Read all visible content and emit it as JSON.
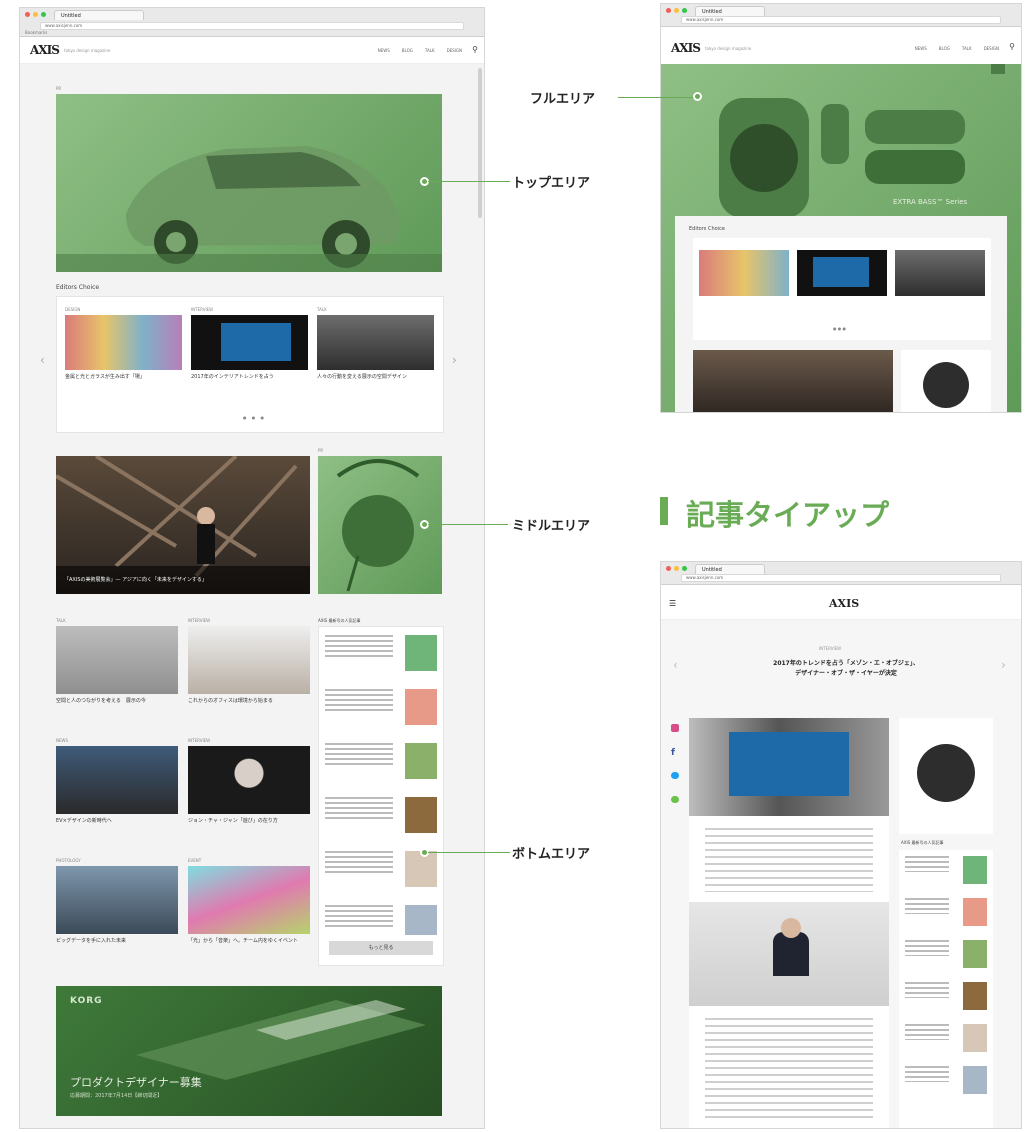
{
  "browser": {
    "tab_title": "Untitled",
    "url": "www.axisjenn.com",
    "bookmarks": "Bookmarks"
  },
  "site": {
    "logo": "AXIS",
    "tagline": "tokyo design magazine",
    "nav": [
      "NEWS",
      "BLOG",
      "TALK",
      "DESIGN"
    ],
    "search_icon": "search-icon"
  },
  "left_page": {
    "top_label": "PR",
    "editors_choice": "Editors Choice",
    "carousel_items": [
      {
        "tag": "DESIGN",
        "caption": "金属と光とガラスが生み出す「場」"
      },
      {
        "tag": "INTERVIEW",
        "caption": "2017年のインテリアトレンドを占う"
      },
      {
        "tag": "TALK",
        "caption": "人々の行動を変える展示の空間デザイン"
      }
    ],
    "middle_feature_caption": "「AXISの美術展覧会」— アジアに向く「未来をデザインする」",
    "side_tag": "PR",
    "grid_items": [
      {
        "tag": "TALK",
        "caption": "空間と人のつながりを考える　展示の今"
      },
      {
        "tag": "INTERVIEW",
        "caption": "これからのオフィスは環境から始まる"
      },
      {
        "tag": "NEWS",
        "caption": "EV×デザインの新時代へ"
      },
      {
        "tag": "INTERVIEW",
        "caption": "ジョン・チャ・ジャン「遊び」の在り方"
      },
      {
        "tag": "PHOTOLOGY",
        "caption": "ピッグデータを手に入れた未来"
      },
      {
        "tag": "EVENT",
        "caption": "「光」から「音楽」へ。チーム内をゆくイベント"
      }
    ],
    "ranking_title": "AXIS 最新号の人気記事",
    "ranking_more": "もっと見る",
    "bottom_brand": "KORG",
    "bottom_title": "プロダクトデザイナー募集",
    "bottom_sub": "応募期間：2017年7月14日【締切間近】"
  },
  "right_top": {
    "banner_text": "EXTRA BASS™ Series",
    "editors_choice": "Editors Choice"
  },
  "right_bottom": {
    "logo": "AXIS",
    "kicker": "INTERVIEW",
    "headline_1": "2017年のトレンドを占う「メゾン・エ・オブジェ」、",
    "headline_2": "デザイナー・オブ・ザ・イヤーが決定",
    "sidebar_title": "AXIS 最新号の人気記事"
  },
  "labels": {
    "full_area": "フルエリア",
    "top_area": "トップエリア",
    "middle_area": "ミドルエリア",
    "bottom_area": "ボトムエリア",
    "article_tieup": "記事タイアップ"
  },
  "colors": {
    "accent": "#6aab55",
    "overlay_light": "#8fbf85",
    "overlay_dark": "#3f7a3a"
  }
}
